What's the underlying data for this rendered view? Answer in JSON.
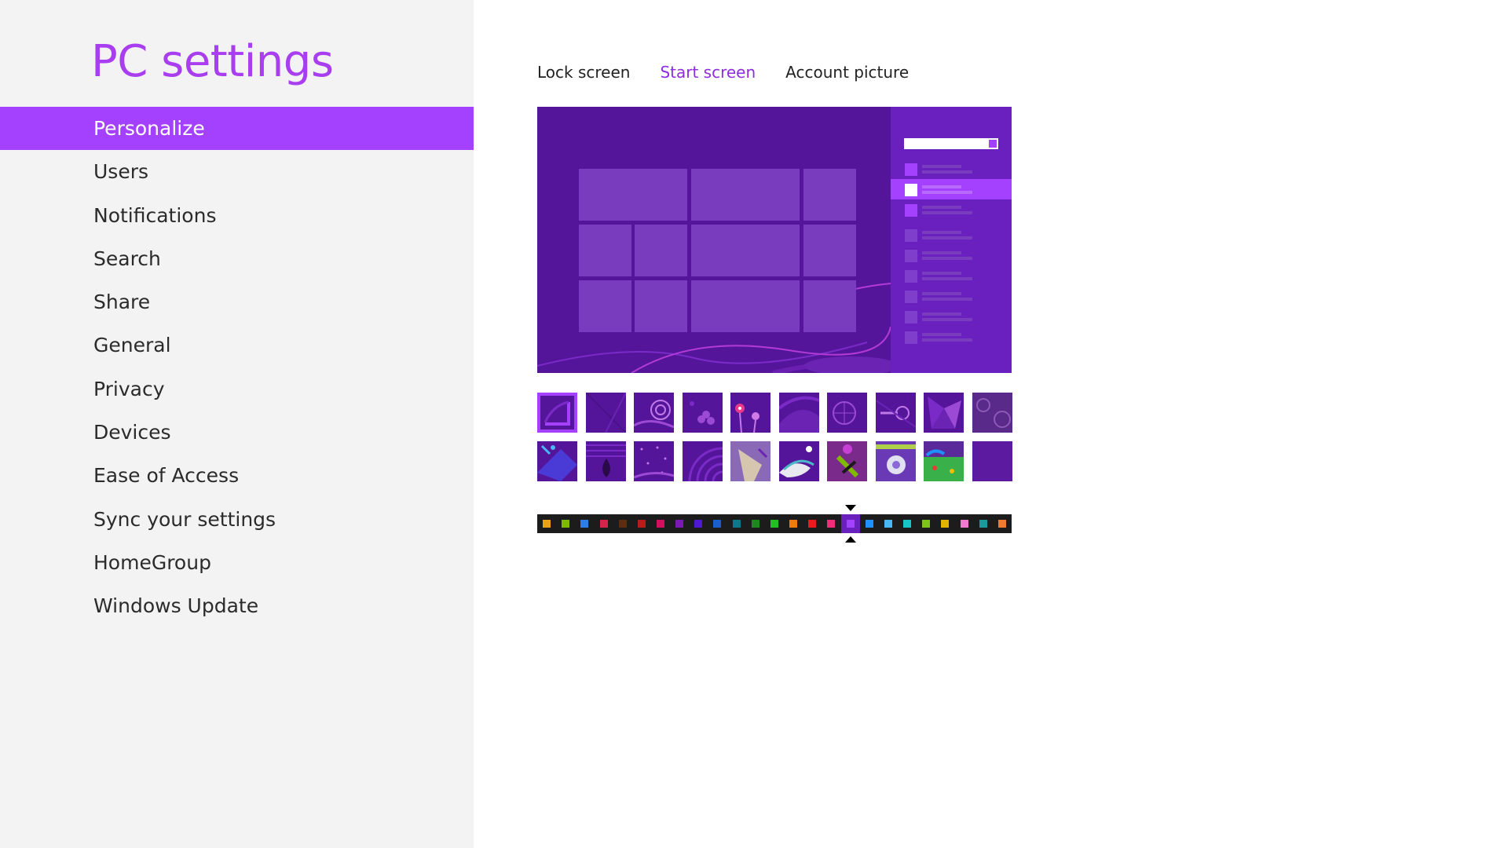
{
  "app": {
    "title": "PC settings"
  },
  "sidebar": {
    "items": [
      {
        "label": "Personalize",
        "active": true
      },
      {
        "label": "Users"
      },
      {
        "label": "Notifications"
      },
      {
        "label": "Search"
      },
      {
        "label": "Share"
      },
      {
        "label": "General"
      },
      {
        "label": "Privacy"
      },
      {
        "label": "Devices"
      },
      {
        "label": "Ease of Access"
      },
      {
        "label": "Sync your settings"
      },
      {
        "label": "HomeGroup"
      },
      {
        "label": "Windows Update"
      }
    ]
  },
  "tabs": [
    {
      "label": "Lock screen"
    },
    {
      "label": "Start screen",
      "active": true
    },
    {
      "label": "Account picture"
    }
  ],
  "theme": {
    "accent": "#a440ff",
    "background": "#55159b",
    "tile": "#7a3cbf",
    "charm": "#6a1fbf"
  },
  "patterns": {
    "count": 20,
    "selected_index": 0
  },
  "color_swatches": [
    "#e8a317",
    "#7fba00",
    "#2d7ee8",
    "#d1254b",
    "#5a2e0e",
    "#b81b1b",
    "#d0115e",
    "#7a1ab6",
    "#4d1acf",
    "#1a5fd0",
    "#0a7a8a",
    "#1a8a1a",
    "#1fc11f",
    "#f07a10",
    "#e81c1c",
    "#ef2e7a",
    "#a440ff",
    "#1e90ff",
    "#4ab8f5",
    "#16c6c6",
    "#7ec21c",
    "#e0b400",
    "#f07ad0",
    "#1a9a9a",
    "#f07a30"
  ],
  "selected_swatch_index": 16
}
